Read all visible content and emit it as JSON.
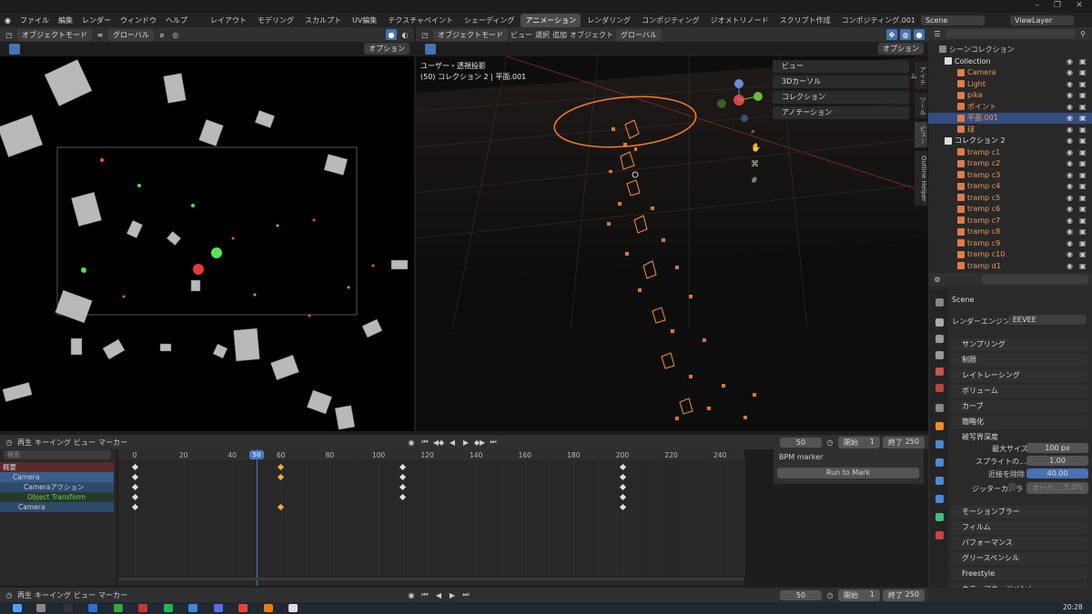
{
  "top_menu": [
    "ファイル",
    "編集",
    "レンダー",
    "ウィンドウ",
    "ヘルプ"
  ],
  "workspaces": [
    "レイアウト",
    "モデリング",
    "スカルプト",
    "UV編集",
    "テクスチャペイント",
    "シェーディング",
    "アニメーション",
    "レンダリング",
    "コンポジティング",
    "ジオメトリノード",
    "スクリプト作成",
    "コンポジティング.001"
  ],
  "active_workspace": "アニメーション",
  "scene_name": "Scene",
  "view_layer": "ViewLayer",
  "left_vp": {
    "mode": "オブジェクトモード",
    "orient": "グローバル",
    "options": "オプション"
  },
  "right_vp": {
    "mode": "オブジェクトモード",
    "menu": [
      "ビュー",
      "選択",
      "追加",
      "オブジェクト"
    ],
    "orient": "グローバル",
    "options": "オプション",
    "info_line1": "ユーザー・透視投影",
    "info_line2": "(50) コレクション 2 | 平面.001",
    "npanel": [
      "ビュー",
      "3Dカーソル",
      "コレクション",
      "アノテーション"
    ],
    "side_tabs": [
      "アイテム",
      "ツール",
      "ビュー",
      "Outline Helper"
    ]
  },
  "outliner": {
    "header": "シーンコレクション",
    "search_placeholder": "",
    "rows": [
      {
        "name": "Collection",
        "type": "collection",
        "indent": 1
      },
      {
        "name": "Camera",
        "type": "camera",
        "indent": 2
      },
      {
        "name": "Light",
        "type": "light",
        "indent": 2
      },
      {
        "name": "pika",
        "type": "obj",
        "indent": 2
      },
      {
        "name": "ポイント",
        "type": "obj",
        "indent": 2
      },
      {
        "name": "平面.001",
        "type": "obj",
        "indent": 2,
        "selected": true
      },
      {
        "name": "球",
        "type": "obj",
        "indent": 2
      },
      {
        "name": "コレクション 2",
        "type": "collection",
        "indent": 1
      },
      {
        "name": "tramp c1",
        "type": "obj",
        "indent": 2
      },
      {
        "name": "tramp c2",
        "type": "obj",
        "indent": 2
      },
      {
        "name": "tramp c3",
        "type": "obj",
        "indent": 2
      },
      {
        "name": "tramp c4",
        "type": "obj",
        "indent": 2
      },
      {
        "name": "tramp c5",
        "type": "obj",
        "indent": 2
      },
      {
        "name": "tramp c6",
        "type": "obj",
        "indent": 2
      },
      {
        "name": "tramp c7",
        "type": "obj",
        "indent": 2
      },
      {
        "name": "tramp c8",
        "type": "obj",
        "indent": 2
      },
      {
        "name": "tramp c9",
        "type": "obj",
        "indent": 2
      },
      {
        "name": "tramp c10",
        "type": "obj",
        "indent": 2
      },
      {
        "name": "tramp d1",
        "type": "obj",
        "indent": 2
      }
    ]
  },
  "properties": {
    "scene": "Scene",
    "render_engine_label": "レンダーエンジン",
    "render_engine": "EEVEE",
    "panels": [
      "サンプリング",
      "制限",
      "レイトレーシング",
      "ボリューム",
      "カーブ",
      "簡略化",
      "被写界深度",
      "モーションブラー",
      "フィルム",
      "パフォーマンス",
      "グリースペンシル",
      "Freestyle",
      "カラーマネージメント"
    ],
    "dof": {
      "max_size_label": "最大サイズ",
      "max_size": "100 px",
      "sprite_label": "スプライトの...",
      "sprite": "1.00",
      "neighbor_label": "近接を除除",
      "neighbor": "40.00",
      "jitter_label": "ジッターカメラ",
      "overblur": "オーバ...",
      "overblur_val": "5.0%"
    }
  },
  "timeline": {
    "menu": [
      "再生",
      "キーイング",
      "ビュー",
      "マーカー"
    ],
    "current_frame": "50",
    "start_label": "開始",
    "start": "1",
    "end_label": "終了",
    "end": "250",
    "frame_labels": [
      "0",
      "20",
      "40",
      "50",
      "60",
      "80",
      "100",
      "120",
      "140",
      "160",
      "180",
      "200",
      "220",
      "240"
    ],
    "search_placeholder": "検索",
    "channels": [
      "概要",
      "Camera",
      "Cameraアクション",
      "Object Transform",
      "Camera"
    ],
    "bpm_panel": "BPM marker",
    "bpm_button": "Run to Mark"
  },
  "clock": "20:28"
}
